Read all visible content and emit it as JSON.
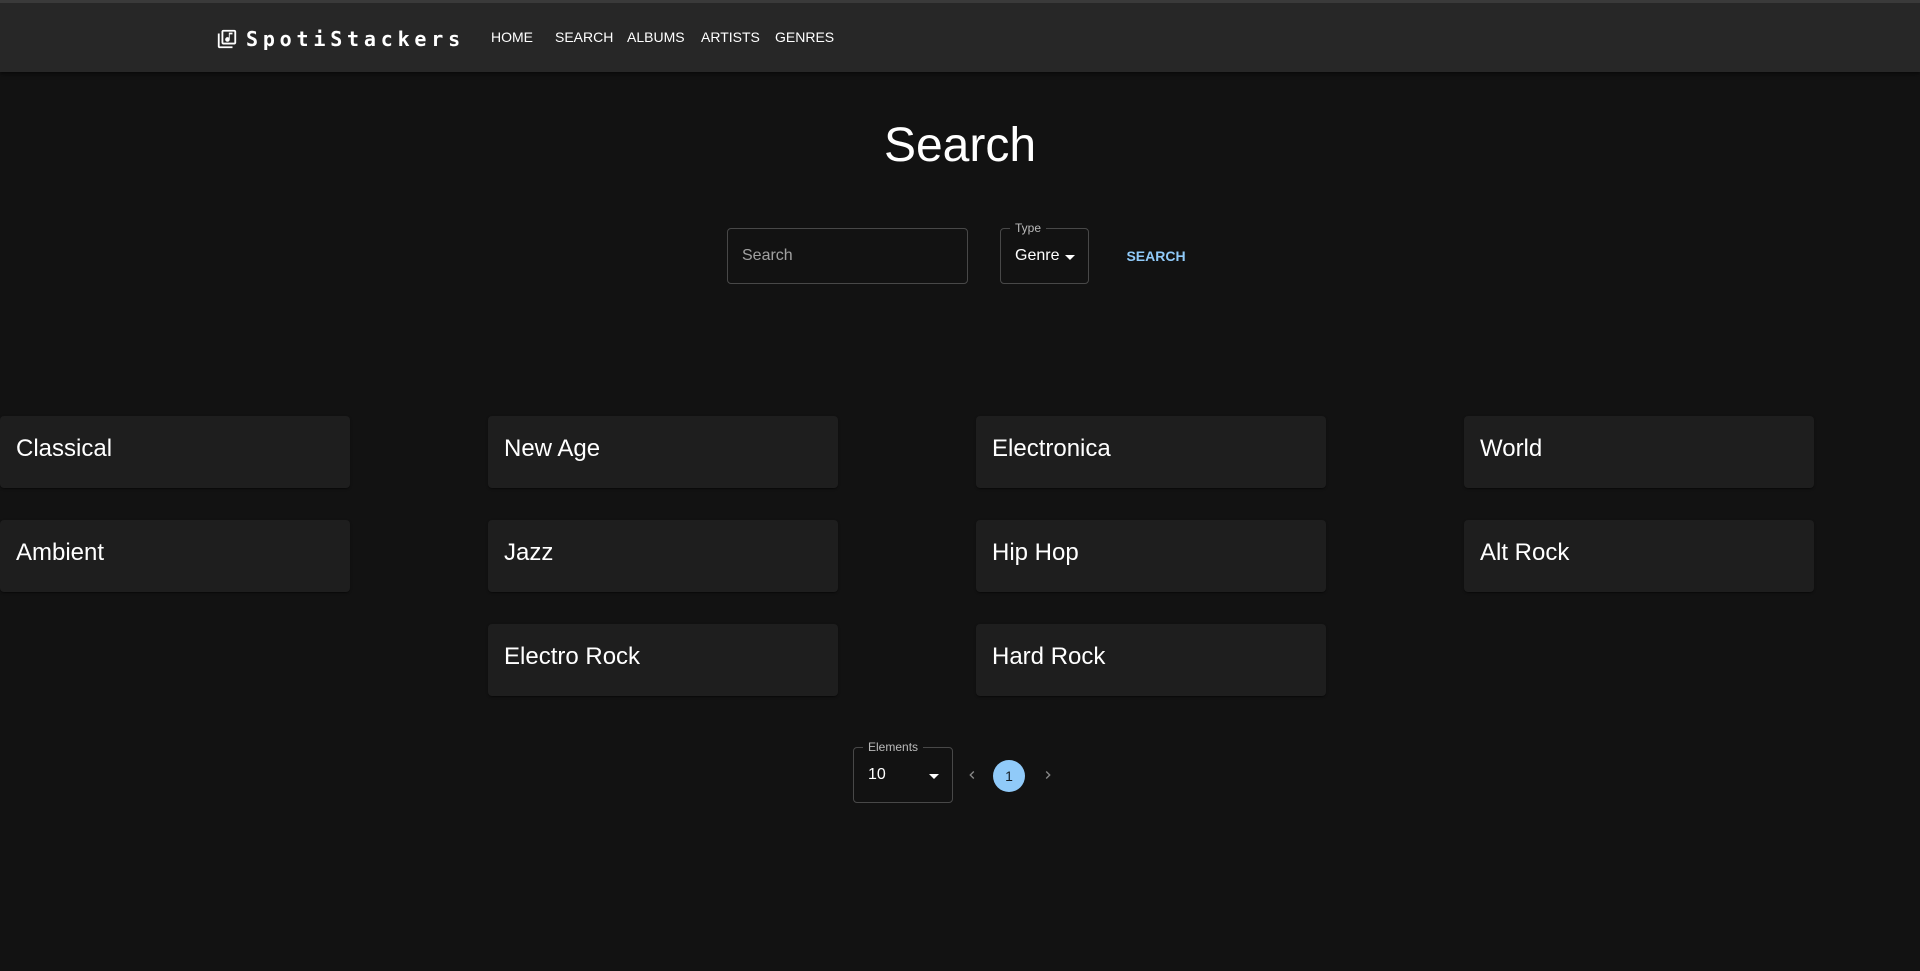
{
  "brand": {
    "name": "SpotiStackers",
    "icon": "music-library-icon"
  },
  "nav": {
    "items": [
      "HOME",
      "SEARCH",
      "ALBUMS",
      "ARTISTS",
      "GENRES"
    ]
  },
  "page": {
    "title": "Search"
  },
  "search": {
    "placeholder": "Search",
    "value": "",
    "type_label": "Type",
    "type_value": "Genre",
    "button_label": "SEARCH"
  },
  "genres": [
    "Classical",
    "New Age",
    "Electronica",
    "World",
    "Ambient",
    "Jazz",
    "Hip Hop",
    "Alt Rock",
    "Electro Rock",
    "Hard Rock"
  ],
  "pagination": {
    "elements_label": "Elements",
    "elements_value": "10",
    "current_page": "1",
    "prev_icon": "chevron-left-icon",
    "next_icon": "chevron-right-icon"
  },
  "colors": {
    "background": "#121212",
    "appbar": "#272727",
    "card": "#1e1e1e",
    "accent": "#90caf9"
  }
}
